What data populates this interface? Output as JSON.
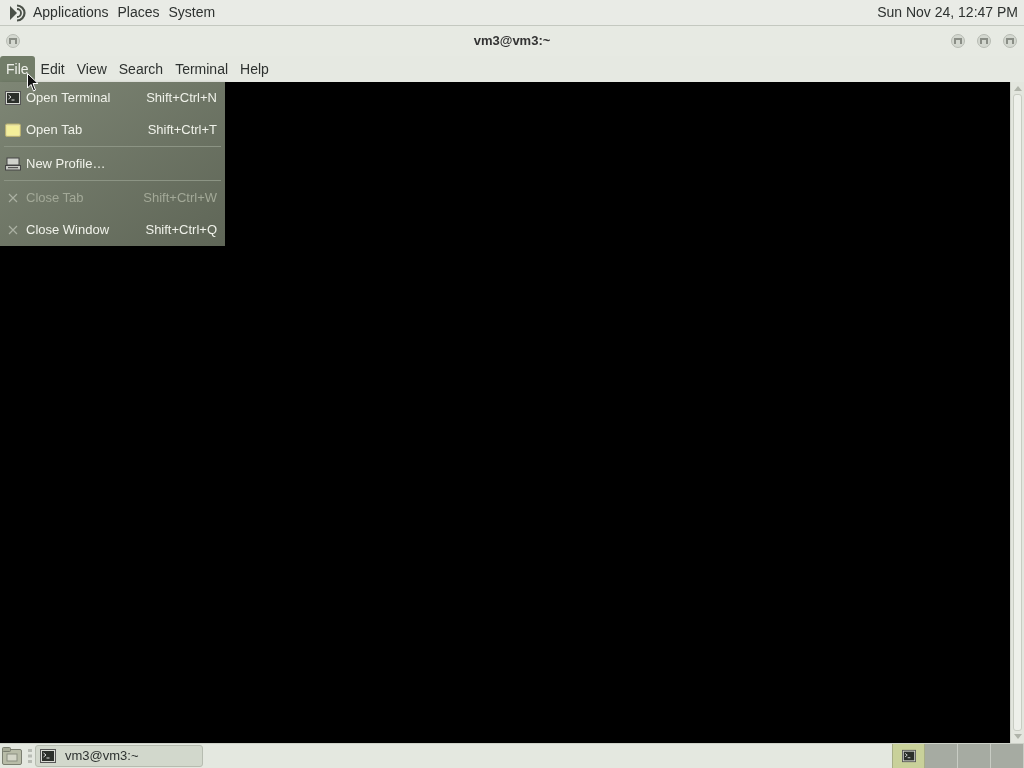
{
  "top_panel": {
    "menus": [
      {
        "label": "Applications"
      },
      {
        "label": "Places"
      },
      {
        "label": "System"
      }
    ],
    "clock": "Sun Nov 24, 12:47 PM"
  },
  "window": {
    "title": "vm3@vm3:~"
  },
  "menubar": [
    {
      "label": "File",
      "selected": true
    },
    {
      "label": "Edit",
      "selected": false
    },
    {
      "label": "View",
      "selected": false
    },
    {
      "label": "Search",
      "selected": false
    },
    {
      "label": "Terminal",
      "selected": false
    },
    {
      "label": "Help",
      "selected": false
    }
  ],
  "file_menu": {
    "items": [
      {
        "kind": "item",
        "label": "Open Terminal",
        "shortcut": "Shift+Ctrl+N",
        "disabled": false
      },
      {
        "kind": "item",
        "label": "Open Tab",
        "shortcut": "Shift+Ctrl+T",
        "disabled": false
      },
      {
        "kind": "separator"
      },
      {
        "kind": "item",
        "label": "New Profile…",
        "disabled": false
      },
      {
        "kind": "separator"
      },
      {
        "kind": "item",
        "label": "Close Tab",
        "shortcut": "Shift+Ctrl+W",
        "disabled": true
      },
      {
        "kind": "item",
        "label": "Close Window",
        "shortcut": "Shift+Ctrl+Q",
        "disabled": false
      }
    ]
  },
  "taskbar": {
    "tasks": [
      {
        "label": "vm3@vm3:~"
      }
    ],
    "workspaces": [
      {
        "selected": true
      },
      {
        "selected": false
      },
      {
        "selected": false
      },
      {
        "selected": false
      }
    ]
  }
}
